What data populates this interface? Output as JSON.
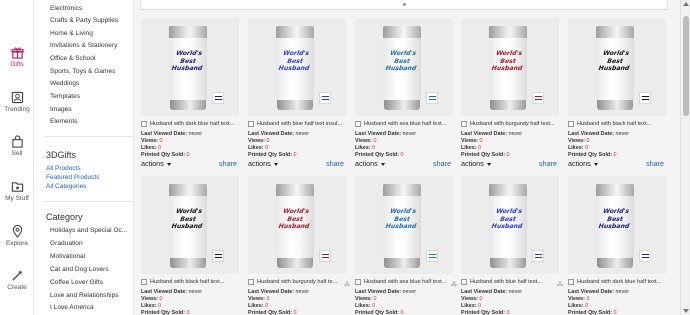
{
  "rail": [
    {
      "label": "Gifts",
      "icon": "gift-icon",
      "active": true
    },
    {
      "label": "Trending",
      "icon": "trending-icon",
      "active": false
    },
    {
      "label": "Sell",
      "icon": "sell-icon",
      "active": false
    },
    {
      "label": "My Stuff",
      "icon": "folder-icon",
      "active": false
    },
    {
      "label": "Explore",
      "icon": "pin-icon",
      "active": false
    },
    {
      "label": "Create",
      "icon": "wand-icon",
      "active": false
    }
  ],
  "sidebar": {
    "top_links": [
      "Electronics",
      "Crafts & Party Supplies",
      "Home & Living",
      "Invitations & Stationery",
      "Office & School",
      "Sports, Toys & Games",
      "Weddings",
      "Templates",
      "Images",
      "Elements"
    ],
    "gifts3d": {
      "heading": "3DGifts",
      "links": [
        "All Products",
        "Featured Products",
        "All Categories"
      ]
    },
    "category": {
      "heading": "Category",
      "items": [
        "Holidays and Special Oc...",
        "Graduation",
        "Motivational",
        "Cat and Dog Lovers",
        "Coffee Lover Gifts",
        "Love and Relationships",
        "I Love America"
      ]
    }
  },
  "labels": {
    "last_viewed": "Last Viewed Date:",
    "views": "Views:",
    "likes": "Likes:",
    "printed": "Printed Qty Sold:",
    "actions": "actions",
    "share": "share"
  },
  "products": [
    {
      "title": "Husband with dark blue half text...",
      "last_viewed": "never",
      "views": "0",
      "likes": "0",
      "printed": "0",
      "text_color": "#1a1a80",
      "mark3d": false
    },
    {
      "title": "Husband with blue half text insulat...",
      "last_viewed": "never",
      "views": "0",
      "likes": "0",
      "printed": "0",
      "text_color": "#2a3bd4",
      "mark3d": false
    },
    {
      "title": "Husband with sea blue half text...",
      "last_viewed": "never",
      "views": "0",
      "likes": "0",
      "printed": "0",
      "text_color": "#1f6fb0",
      "mark3d": false
    },
    {
      "title": "Husband with burgundy half text...",
      "last_viewed": "never",
      "views": "0",
      "likes": "0",
      "printed": "0",
      "text_color": "#a8182c",
      "mark3d": false
    },
    {
      "title": "Husband with black half text...",
      "last_viewed": "never",
      "views": "0",
      "likes": "0",
      "printed": "0",
      "text_color": "#111111",
      "mark3d": false
    },
    {
      "title": "Husband with black half text...",
      "last_viewed": "never",
      "views": "0",
      "likes": "0",
      "printed": "0",
      "text_color": "#111111",
      "mark3d": false
    },
    {
      "title": "Husband with burgundy half te...",
      "last_viewed": "never",
      "views": "0",
      "likes": "0",
      "printed": "0",
      "text_color": "#a8182c",
      "mark3d": true
    },
    {
      "title": "Husband with sea blue half text...",
      "last_viewed": "never",
      "views": "0",
      "likes": "0",
      "printed": "0",
      "text_color": "#1f6fb0",
      "mark3d": true
    },
    {
      "title": "Husband with blue half text...",
      "last_viewed": "never",
      "views": "0",
      "likes": "0",
      "printed": "0",
      "text_color": "#2a3bd4",
      "mark3d": true
    },
    {
      "title": "Husband with dark blue half text...",
      "last_viewed": "never",
      "views": "0",
      "likes": "0",
      "printed": "0",
      "text_color": "#1a1a80",
      "mark3d": false
    }
  ],
  "product_art_text": [
    "World's Best",
    "Husband"
  ],
  "colors": {
    "accent": "#c2185b",
    "link": "#2a62c9",
    "share": "#1565c0",
    "stat_value": "#d32f2f"
  }
}
